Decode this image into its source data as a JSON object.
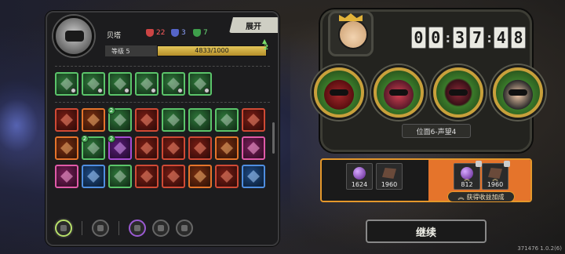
{
  "hero": {
    "name": "贝塔",
    "stats": {
      "red": "22",
      "blue": "3",
      "green": "7"
    },
    "expand_label": "展开",
    "level_label": "等级 5",
    "exp_text": "4833/1000",
    "exp_progress": 1.0,
    "level_badge": "2"
  },
  "skills": {
    "active_row": [
      "green",
      "green",
      "green",
      "green",
      "green",
      "green"
    ],
    "grid": [
      [
        "red",
        "orange",
        "green",
        "red",
        "green",
        "green",
        "green",
        "red"
      ],
      [
        "orange",
        "green",
        "purple",
        "red",
        "red",
        "red",
        "orange",
        "pink"
      ],
      [
        "pink",
        "blue",
        "green",
        "red",
        "red",
        "orange",
        "red",
        "blue"
      ]
    ]
  },
  "timer": {
    "digits": [
      "0",
      "0",
      "3",
      "7",
      "4",
      "8"
    ]
  },
  "location": "位面6-声望4",
  "rewards": {
    "base": [
      {
        "type": "gem",
        "count": "1624"
      },
      {
        "type": "rock",
        "count": "1960"
      }
    ],
    "bonus": [
      {
        "type": "gem",
        "count": "812"
      },
      {
        "type": "rock",
        "count": "1960"
      }
    ],
    "bonus_label": "获得收益加成"
  },
  "continue_label": "继续",
  "version": "371476 1.0.2(6)"
}
